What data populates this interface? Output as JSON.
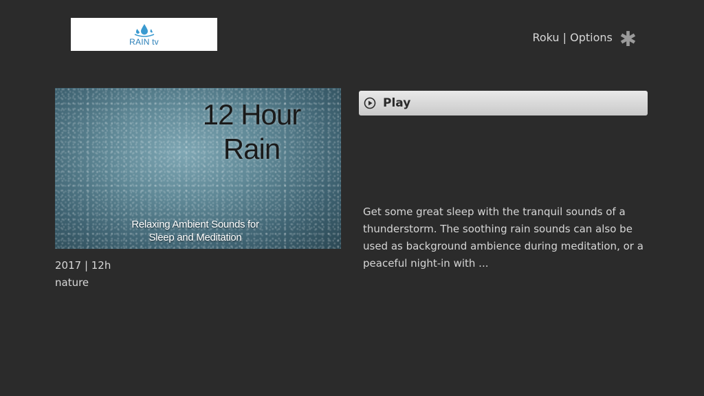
{
  "header": {
    "logo_text": "RAIN tv",
    "options_label": "Roku | Options",
    "options_icon": "asterisk-icon"
  },
  "poster": {
    "title": "12 Hour Rain",
    "subtitle": "Relaxing Ambient Sounds for Sleep and Meditation"
  },
  "meta": {
    "year_duration": "2017 | 12h",
    "genre": "nature"
  },
  "actions": {
    "play_label": "Play",
    "play_icon": "play-circle-icon"
  },
  "description": "Get some great sleep with the tranquil sounds of a thunderstorm. The soothing rain sounds can also be used as background ambience during meditation, or a peaceful night-in with ...",
  "colors": {
    "background": "#2b2b2b",
    "button": "#d9d9d9",
    "logo_accent": "#2a7fb8"
  }
}
